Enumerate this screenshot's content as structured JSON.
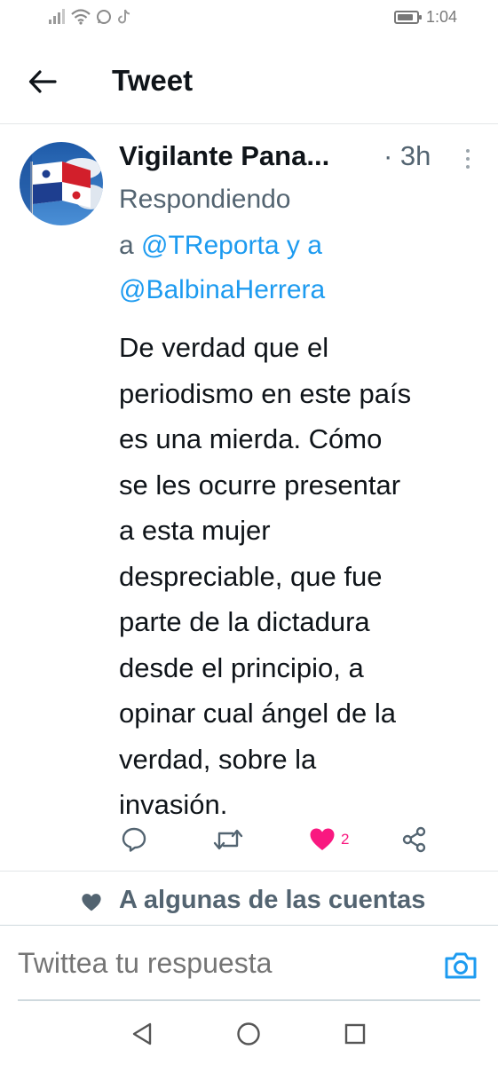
{
  "status_bar": {
    "time": "1:04",
    "battery_level": 0.85
  },
  "header": {
    "title": "Tweet"
  },
  "tweet": {
    "display_name": "Vigilante Pana...",
    "time": "· 3h",
    "reply_line1": "Respondiendo",
    "reply_prefix": "a",
    "mention1": "@TReporta",
    "reply_conjunction": "y a",
    "mention2": "@BalbinaHerrera",
    "text_lines": [
      "De verdad que el",
      "periodismo en este país",
      "es una mierda. Cómo",
      "se les ocurre presentar",
      "a esta mujer",
      "despreciable, que fue",
      "parte de la dictadura",
      "desde el principio, a",
      "opinar cual ángel de la",
      "verdad, sobre la",
      "invasión."
    ],
    "like_count": "2",
    "accent_color": "#1d9bf0",
    "like_color": "#f91880"
  },
  "liked_by": {
    "text": "A algunas de las cuentas"
  },
  "composer": {
    "placeholder": "Twittea tu respuesta"
  },
  "icons": {
    "back": "arrow-left-icon",
    "more": "more-vertical-icon",
    "reply": "reply-icon",
    "retweet": "retweet-icon",
    "like": "heart-icon",
    "share": "share-icon",
    "camera": "camera-icon",
    "nav_back": "triangle-back-icon",
    "nav_home": "circle-home-icon",
    "nav_recents": "square-recents-icon"
  }
}
